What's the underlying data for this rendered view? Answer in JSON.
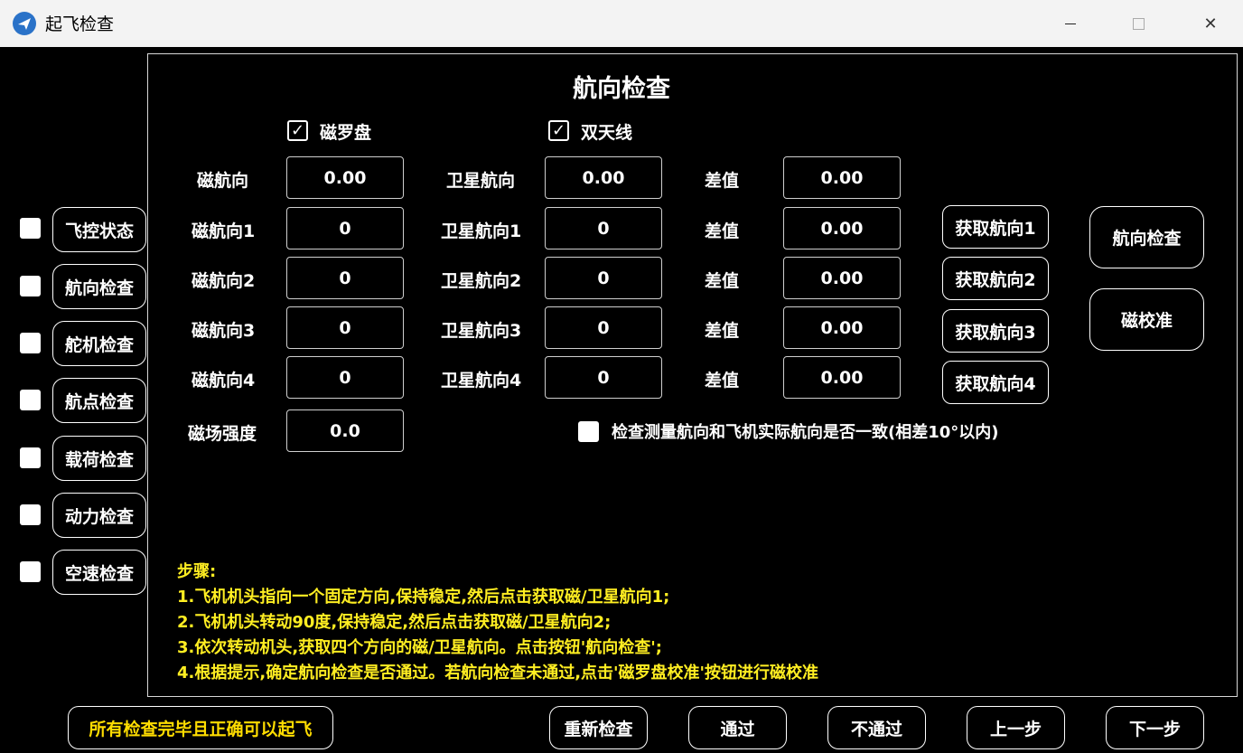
{
  "window": {
    "title": "起飞检查"
  },
  "sidebar": {
    "items": [
      {
        "label": "飞控状态"
      },
      {
        "label": "航向检查"
      },
      {
        "label": "舵机检查"
      },
      {
        "label": "航点检查"
      },
      {
        "label": "载荷检查"
      },
      {
        "label": "动力检查"
      },
      {
        "label": "空速检查"
      }
    ]
  },
  "panel": {
    "title": "航向检查",
    "compass_label": "磁罗盘",
    "dual_antenna_label": "双天线",
    "rows": [
      {
        "mag_label": "磁航向",
        "mag_value": "0.00",
        "sat_label": "卫星航向",
        "sat_value": "0.00",
        "diff_label": "差值",
        "diff_value": "0.00"
      },
      {
        "mag_label": "磁航向1",
        "mag_value": "0",
        "sat_label": "卫星航向1",
        "sat_value": "0",
        "diff_label": "差值",
        "diff_value": "0.00",
        "get_label": "获取航向1"
      },
      {
        "mag_label": "磁航向2",
        "mag_value": "0",
        "sat_label": "卫星航向2",
        "sat_value": "0",
        "diff_label": "差值",
        "diff_value": "0.00",
        "get_label": "获取航向2"
      },
      {
        "mag_label": "磁航向3",
        "mag_value": "0",
        "sat_label": "卫星航向3",
        "sat_value": "0",
        "diff_label": "差值",
        "diff_value": "0.00",
        "get_label": "获取航向3"
      },
      {
        "mag_label": "磁航向4",
        "mag_value": "0",
        "sat_label": "卫星航向4",
        "sat_value": "0",
        "diff_label": "差值",
        "diff_value": "0.00",
        "get_label": "获取航向4"
      }
    ],
    "field_strength_label": "磁场强度",
    "field_strength_value": "0.0",
    "consistency_label": "检查测量航向和飞机实际航向是否一致(相差10°以内)",
    "heading_check_button": "航向检查",
    "mag_calib_button": "磁校准",
    "steps": [
      "步骤:",
      "1.飞机机头指向一个固定方向,保持稳定,然后点击获取磁/卫星航向1;",
      "2.飞机机头转动90度,保持稳定,然后点击获取磁/卫星航向2;",
      "3.依次转动机头,获取四个方向的磁/卫星航向。点击按钮'航向检查';",
      "4.根据提示,确定航向检查是否通过。若航向检查未通过,点击'磁罗盘校准'按钮进行磁校准"
    ]
  },
  "footer": {
    "ready_label": "所有检查完毕且正确可以起飞",
    "recheck": "重新检查",
    "pass": "通过",
    "fail": "不通过",
    "prev": "上一步",
    "next": "下一步"
  },
  "colors": {
    "background": "#000000",
    "steps_text": "#ffee22",
    "ready_text": "#ffdd00"
  }
}
